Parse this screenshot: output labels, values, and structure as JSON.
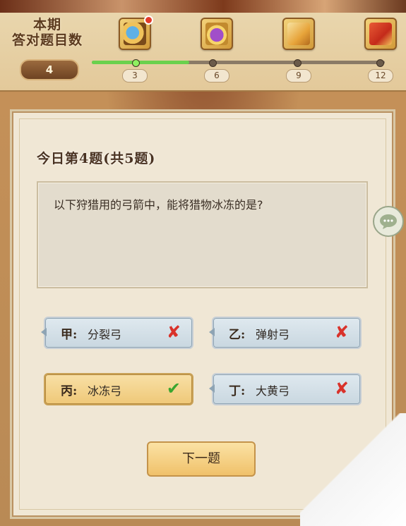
{
  "count": {
    "title_line1": "本期",
    "title_line2": "答对题目数",
    "value": "4"
  },
  "progress": {
    "current": 4,
    "max": 12,
    "milestones": [
      "3",
      "6",
      "9",
      "12"
    ]
  },
  "rewards": [
    {
      "icon": "wave-badge-icon",
      "new_dot": true
    },
    {
      "icon": "purple-pouch-icon",
      "new_dot": false
    },
    {
      "icon": "scroll-icon",
      "new_dot": false
    },
    {
      "icon": "red-pack-icon",
      "new_dot": false
    }
  ],
  "quiz": {
    "header": "今日第4题(共5题)",
    "question": "以下狩猎用的弓箭中，能将猎物冰冻的是?",
    "options": [
      {
        "label": "甲:",
        "text": "分裂弓",
        "result": "wrong"
      },
      {
        "label": "乙:",
        "text": "弹射弓",
        "result": "wrong"
      },
      {
        "label": "丙:",
        "text": "冰冻弓",
        "result": "correct"
      },
      {
        "label": "丁:",
        "text": "大黄弓",
        "result": "wrong"
      }
    ],
    "next_label": "下一题"
  },
  "colors": {
    "correct": "#3aa62f",
    "wrong": "#d9322a",
    "progress_fill": "#6ad14d"
  }
}
